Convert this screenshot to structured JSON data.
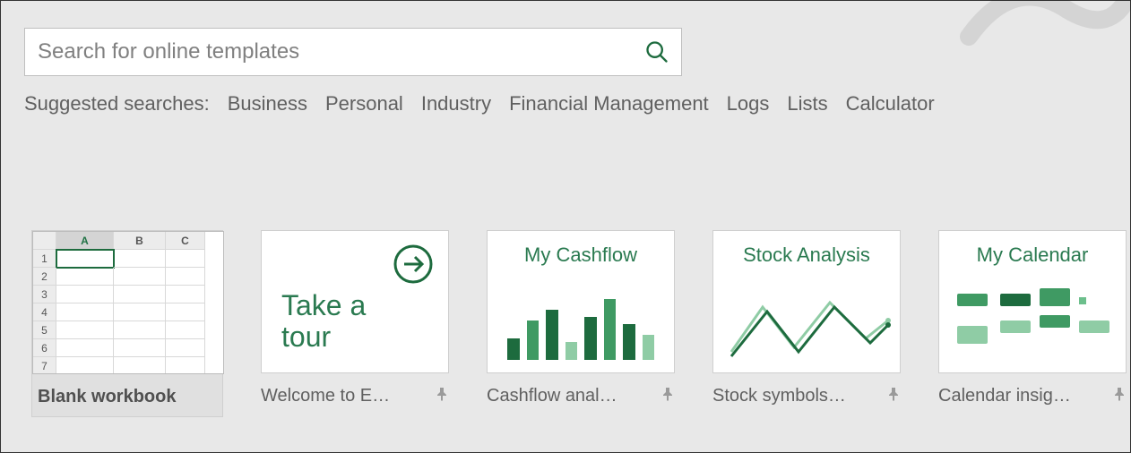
{
  "search": {
    "placeholder": "Search for online templates"
  },
  "suggested": {
    "label": "Suggested searches:",
    "links": [
      "Business",
      "Personal",
      "Industry",
      "Financial Management",
      "Logs",
      "Lists",
      "Calculator"
    ]
  },
  "templates": {
    "blank": {
      "caption": "Blank workbook"
    },
    "tour": {
      "thumb_line1": "Take a",
      "thumb_line2": "tour",
      "caption": "Welcome to E…"
    },
    "cashflow": {
      "thumb_title": "My Cashflow",
      "caption": "Cashflow anal…"
    },
    "stock": {
      "thumb_title": "Stock Analysis",
      "caption": "Stock symbols…"
    },
    "calendar": {
      "thumb_title": "My Calendar",
      "caption": "Calendar insig…"
    }
  },
  "mini_sheet": {
    "cols": [
      "A",
      "B",
      "C"
    ],
    "rows": [
      "1",
      "2",
      "3",
      "4",
      "5",
      "6",
      "7"
    ]
  },
  "colors": {
    "dark_green": "#1d6b3e",
    "mid_green": "#3f9a63",
    "light_green": "#8fcca5"
  }
}
